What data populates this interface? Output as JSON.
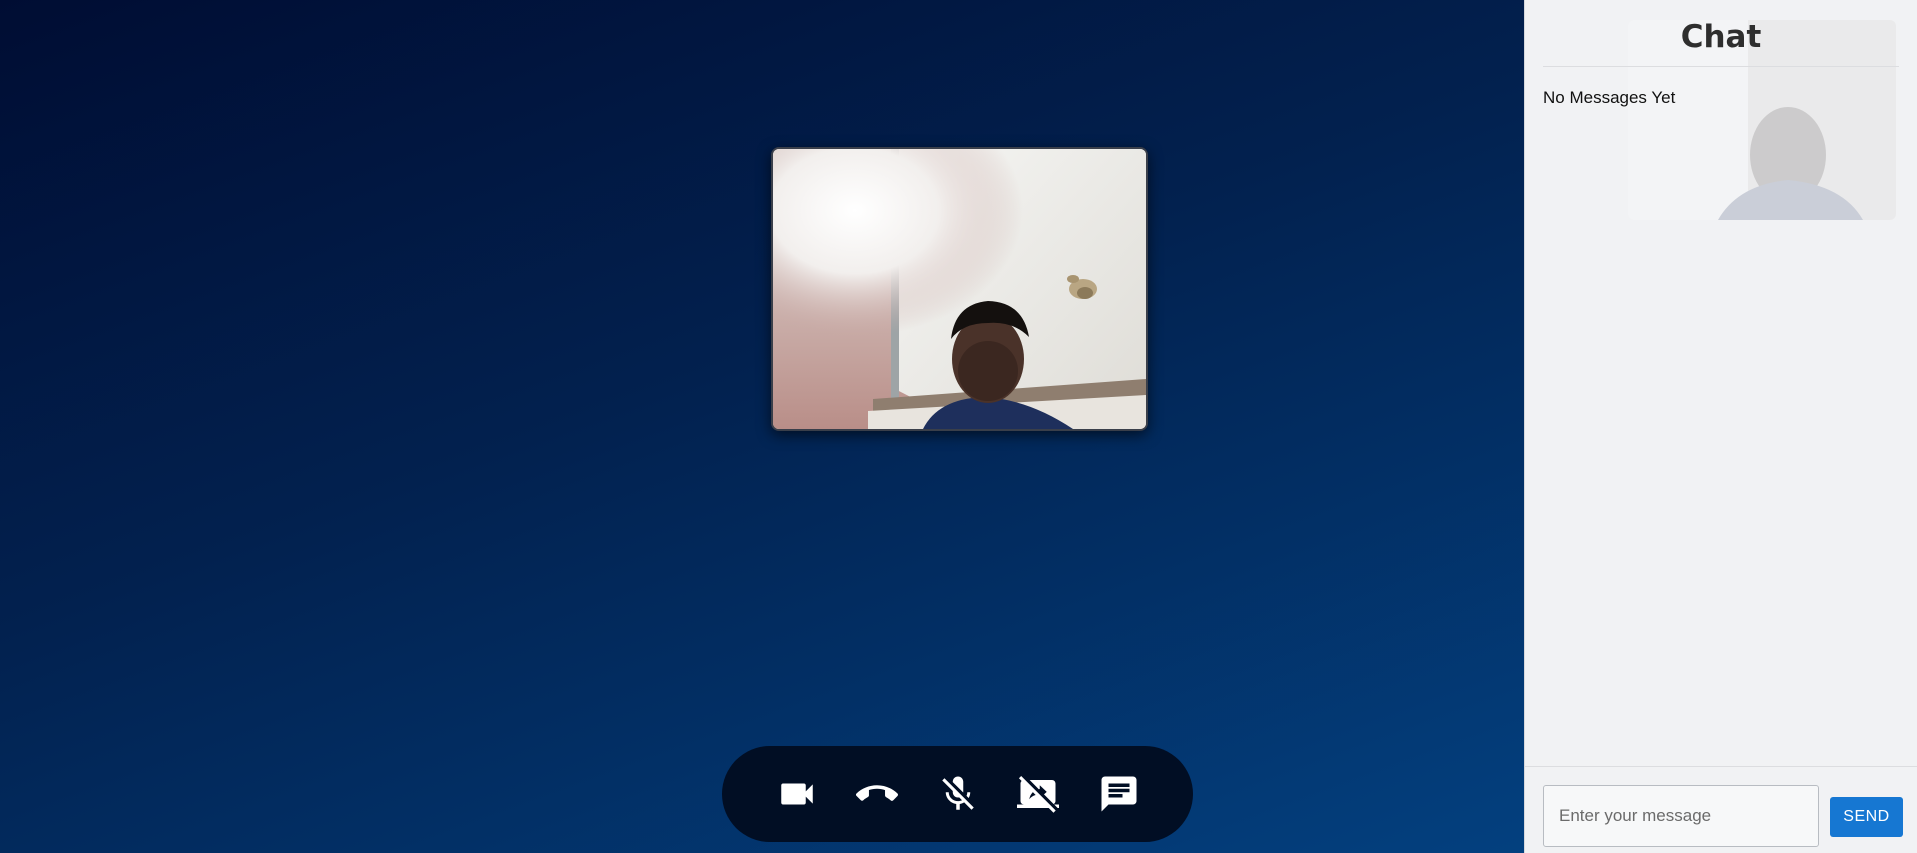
{
  "chat": {
    "title": "Chat",
    "empty_message": "No Messages Yet",
    "input_placeholder": "Enter your message",
    "send_label": "SEND"
  },
  "controls": [
    {
      "icon": "video-camera-icon"
    },
    {
      "icon": "hang-up-phone-icon"
    },
    {
      "icon": "mic-off-icon"
    },
    {
      "icon": "screen-share-off-icon"
    },
    {
      "icon": "chat-icon"
    }
  ],
  "colors": {
    "control_bar": "#010e24",
    "send_button": "#1677d2",
    "chat_panel_bg": "#f1f2f4"
  }
}
